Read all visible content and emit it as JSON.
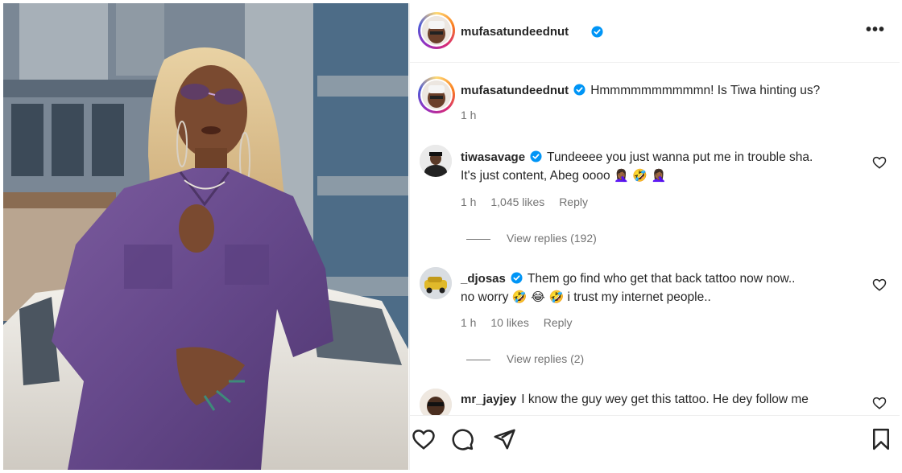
{
  "post": {
    "username": "mufasatundeednut",
    "more_icon": "•••"
  },
  "caption": {
    "username": "mufasatundeednut",
    "text": "Hmmmmmmmmmmn! Is Tiwa hinting us?",
    "time": "1 h"
  },
  "comments": [
    {
      "username": "tiwasavage",
      "verified": true,
      "line1": "Tundeeee you just wanna put me in trouble sha.",
      "line2": "It's just content, Abeg oooo",
      "emoji": "🤦🏾‍♀️ 🤣 🤦🏾‍♀️",
      "time": "1 h",
      "likes": "1,045 likes",
      "reply": "Reply",
      "view_replies": "View replies (192)"
    },
    {
      "username": "_djosas",
      "verified": true,
      "line1": "Them go find who get that back tattoo now now..",
      "line2_a": "no worry",
      "emoji": "🤣 😂 🤣",
      "line2_b": "i trust my internet people..",
      "time": "1 h",
      "likes": "10 likes",
      "reply": "Reply",
      "view_replies": "View replies (2)"
    },
    {
      "username": "mr_jayjey",
      "verified": false,
      "line1": "I know the guy wey get this tattoo. He dey follow me"
    }
  ],
  "icons": {
    "like": "heart-icon",
    "comment": "comment-icon",
    "share": "share-icon",
    "save": "bookmark-icon",
    "verified": "verified-badge-icon"
  },
  "colors": {
    "verified_blue": "#0095f6",
    "outfit_purple": "#6b4e8c",
    "muted_text": "#737373"
  }
}
